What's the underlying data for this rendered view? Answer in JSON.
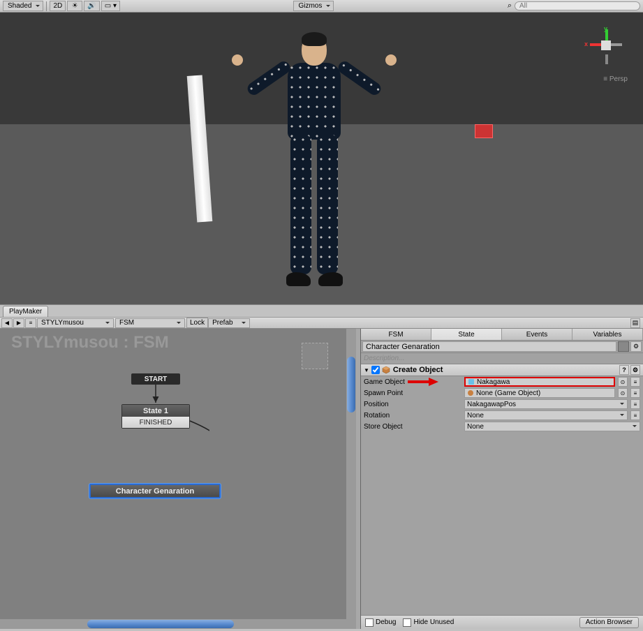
{
  "scene_toolbar": {
    "shading": "Shaded",
    "view_mode": "2D",
    "gizmos": "Gizmos",
    "search_icon": "⌕",
    "search_placeholder": "All"
  },
  "axis": {
    "y": "y",
    "x": "x",
    "persp": "≡ Persp"
  },
  "playmaker": {
    "tab": "PlayMaker",
    "nav_back": "◀",
    "nav_fwd": "▶",
    "obj_dd": "STYLYmusou",
    "fsm_dd": "FSM",
    "lock": "Lock",
    "prefab": "Prefab",
    "fsm_title": "STYLYmusou : FSM",
    "start": "START",
    "state1_name": "State 1",
    "state1_event": "FINISHED",
    "state2_name": "Character Genaration"
  },
  "inspector": {
    "tabs": {
      "fsm": "FSM",
      "state": "State",
      "events": "Events",
      "variables": "Variables"
    },
    "state_name": "Character Genaration",
    "description": "Description...",
    "action_title": "Create Object",
    "props": {
      "game_object_label": "Game Object",
      "game_object_value": "Nakagawa",
      "spawn_point_label": "Spawn Point",
      "spawn_point_value": "None (Game Object)",
      "position_label": "Position",
      "position_value": "NakagawapPos",
      "rotation_label": "Rotation",
      "rotation_value": "None",
      "store_object_label": "Store Object",
      "store_object_value": "None"
    }
  },
  "bottom": {
    "debug": "Debug",
    "hide_unused": "Hide Unused",
    "action_browser": "Action Browser"
  }
}
